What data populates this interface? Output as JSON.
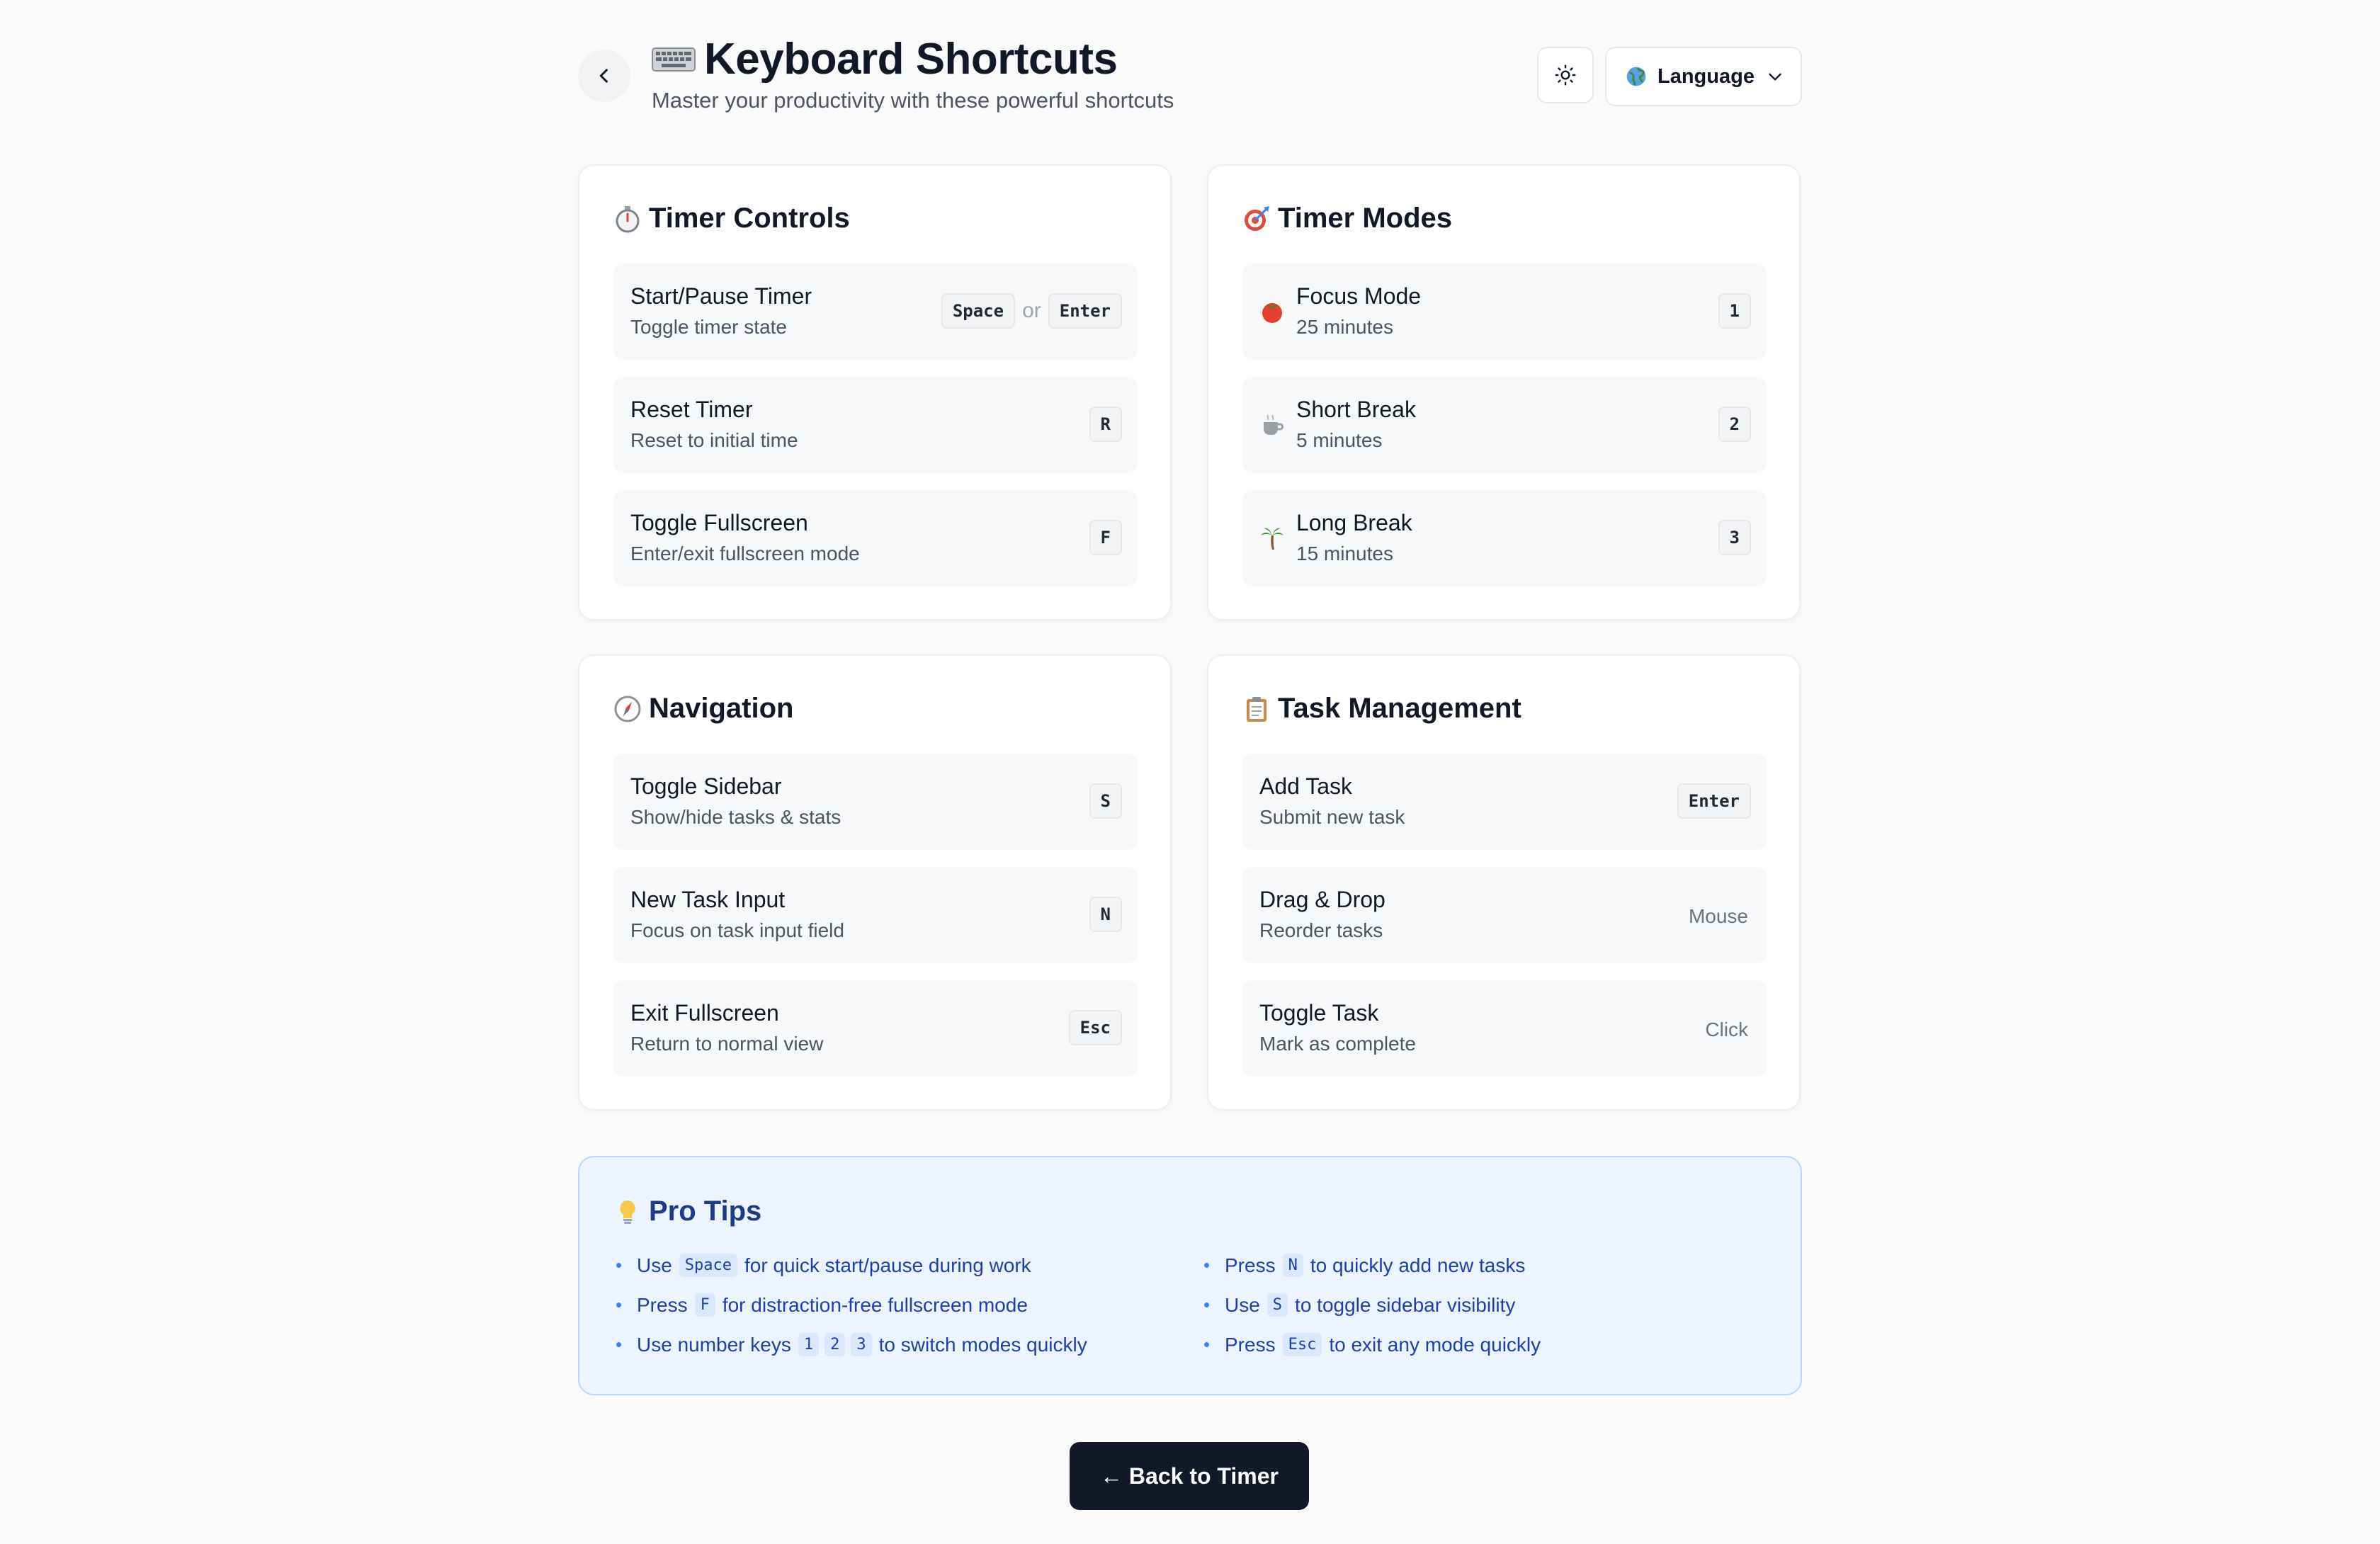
{
  "header": {
    "title": "Keyboard Shortcuts",
    "subtitle": "Master your productivity with these powerful shortcuts",
    "title_icon": "keyboard-icon",
    "back_icon": "chevron-left-icon",
    "theme_icon": "sun-icon",
    "language_label": "Language"
  },
  "sections": {
    "timer_controls": {
      "title": "Timer Controls",
      "icon": "stopwatch-icon",
      "rows": [
        {
          "label": "Start/Pause Timer",
          "desc": "Toggle timer state",
          "keys": [
            "Space",
            "Enter"
          ],
          "or": "or"
        },
        {
          "label": "Reset Timer",
          "desc": "Reset to initial time",
          "keys": [
            "R"
          ]
        },
        {
          "label": "Toggle Fullscreen",
          "desc": "Enter/exit fullscreen mode",
          "keys": [
            "F"
          ]
        }
      ]
    },
    "timer_modes": {
      "title": "Timer Modes",
      "icon": "target-icon",
      "rows": [
        {
          "label": "Focus Mode",
          "desc": "25 minutes",
          "keys": [
            "1"
          ],
          "icon": "tomato-icon"
        },
        {
          "label": "Short Break",
          "desc": "5 minutes",
          "keys": [
            "2"
          ],
          "icon": "coffee-icon"
        },
        {
          "label": "Long Break",
          "desc": "15 minutes",
          "keys": [
            "3"
          ],
          "icon": "palm-tree-icon"
        }
      ]
    },
    "navigation": {
      "title": "Navigation",
      "icon": "compass-icon",
      "rows": [
        {
          "label": "Toggle Sidebar",
          "desc": "Show/hide tasks & stats",
          "keys": [
            "S"
          ]
        },
        {
          "label": "New Task Input",
          "desc": "Focus on task input field",
          "keys": [
            "N"
          ]
        },
        {
          "label": "Exit Fullscreen",
          "desc": "Return to normal view",
          "keys": [
            "Esc"
          ]
        }
      ]
    },
    "task_management": {
      "title": "Task Management",
      "icon": "clipboard-icon",
      "rows": [
        {
          "label": "Add Task",
          "desc": "Submit new task",
          "keys": [
            "Enter"
          ]
        },
        {
          "label": "Drag & Drop",
          "desc": "Reorder tasks",
          "plain": "Mouse"
        },
        {
          "label": "Toggle Task",
          "desc": "Mark as complete",
          "plain": "Click"
        }
      ]
    }
  },
  "pro_tips": {
    "title": "Pro Tips",
    "icon": "lightbulb-icon",
    "left": [
      {
        "pre": "Use",
        "codes": [
          "Space"
        ],
        "post": "for quick start/pause during work"
      },
      {
        "pre": "Press",
        "codes": [
          "F"
        ],
        "post": "for distraction-free fullscreen mode"
      },
      {
        "pre": "Use number keys",
        "codes": [
          "1",
          "2",
          "3"
        ],
        "post": "to switch modes quickly"
      }
    ],
    "right": [
      {
        "pre": "Press",
        "codes": [
          "N"
        ],
        "post": "to quickly add new tasks"
      },
      {
        "pre": "Use",
        "codes": [
          "S"
        ],
        "post": "to toggle sidebar visibility"
      },
      {
        "pre": "Press",
        "codes": [
          "Esc"
        ],
        "post": "to exit any mode quickly"
      }
    ]
  },
  "footer": {
    "back_button": "← Back to Timer"
  },
  "colors": {
    "background": "#fafafa",
    "primary_button": "#111827",
    "tips_background": "#eef4ff",
    "tips_text": "#1e40af"
  }
}
